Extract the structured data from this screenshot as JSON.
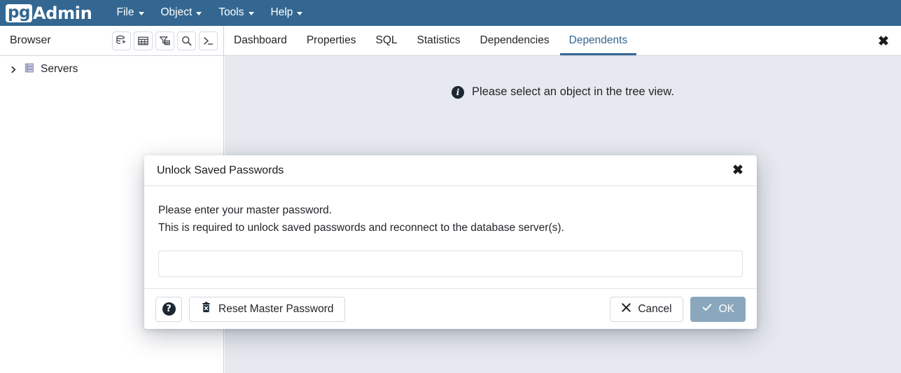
{
  "app": {
    "logo_pg": "pg",
    "logo_admin": "Admin"
  },
  "menubar": {
    "items": [
      {
        "label": "File",
        "icon": "chevron-down-icon"
      },
      {
        "label": "Object",
        "icon": "chevron-down-icon"
      },
      {
        "label": "Tools",
        "icon": "chevron-down-icon"
      },
      {
        "label": "Help",
        "icon": "chevron-down-icon"
      }
    ]
  },
  "browser": {
    "title": "Browser",
    "tools": [
      {
        "name": "query-tool-icon",
        "tooltip": "Query Tool"
      },
      {
        "name": "view-data-icon",
        "tooltip": "View Data"
      },
      {
        "name": "filtered-rows-icon",
        "tooltip": "Filtered Rows"
      },
      {
        "name": "search-icon",
        "tooltip": "Search Objects"
      },
      {
        "name": "psql-terminal-icon",
        "tooltip": "PSQL Tool"
      }
    ],
    "tree": [
      {
        "label": "Servers",
        "icon": "servers-icon",
        "chevron": "chevron-right-icon",
        "expanded": false
      }
    ]
  },
  "tabs": {
    "items": [
      {
        "label": "Dashboard",
        "active": false
      },
      {
        "label": "Properties",
        "active": false
      },
      {
        "label": "SQL",
        "active": false
      },
      {
        "label": "Statistics",
        "active": false
      },
      {
        "label": "Dependencies",
        "active": false
      },
      {
        "label": "Dependents",
        "active": true
      }
    ],
    "close_label": "✖"
  },
  "main": {
    "empty_message": "Please select an object in the tree view.",
    "info_icon": "info-icon"
  },
  "dialog": {
    "title": "Unlock Saved Passwords",
    "close_label": "✖",
    "line1": "Please enter your master password.",
    "line2": "This is required to unlock saved passwords and reconnect to the database server(s).",
    "password": {
      "value": "",
      "placeholder": ""
    },
    "buttons": {
      "help": "?",
      "reset": "Reset Master Password",
      "cancel": "Cancel",
      "ok": "OK"
    }
  },
  "colors": {
    "brand_blue": "#336791",
    "content_bg": "#e6e9ef",
    "ok_button": "#8aa7bd",
    "border": "#cfd4dc",
    "tree_icon": "#b4b6d4"
  }
}
